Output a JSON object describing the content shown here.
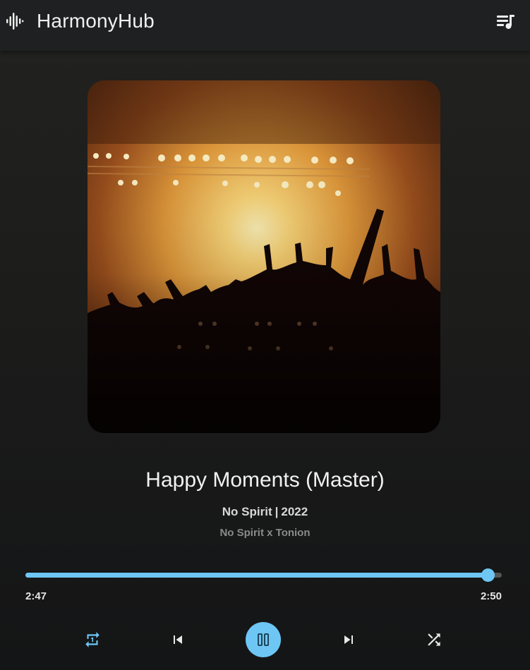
{
  "app": {
    "name": "HarmonyHub"
  },
  "track": {
    "title": "Happy Moments (Master)",
    "artist": "No Spirit",
    "year": "2022",
    "artist_separator": "|",
    "credits": "No Spirit x Tonion"
  },
  "playback": {
    "current_time": "2:47",
    "total_time": "2:50",
    "progress": 0.97,
    "state": "playing"
  },
  "icons": {
    "logo": "sound-wave-icon",
    "queue": "queue-music-icon",
    "repeat": "repeat-one-icon",
    "previous": "skip-previous-icon",
    "play_pause": "pause-icon",
    "next": "skip-next-icon",
    "shuffle": "shuffle-icon"
  },
  "colors": {
    "accent": "#6ec6f5",
    "track_bg": "#555555",
    "header_bg": "#1f2021",
    "text": "#f0f0f0",
    "muted": "#8a8a8a"
  }
}
